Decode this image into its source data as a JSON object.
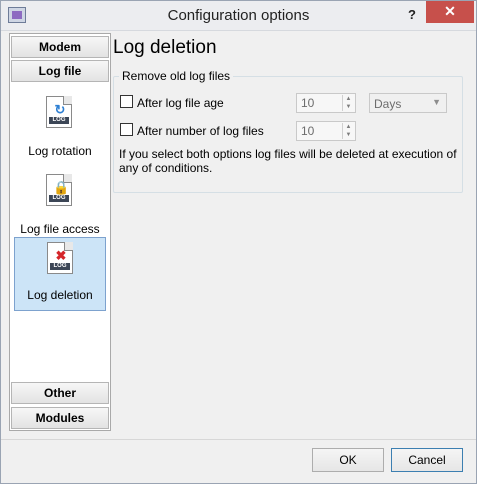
{
  "window": {
    "title": "Configuration options",
    "help_label": "?",
    "close_label": "✕"
  },
  "sidebar": {
    "top_buttons": [
      {
        "label": "Modem"
      },
      {
        "label": "Log file"
      }
    ],
    "items": [
      {
        "label": "Log rotation",
        "icon": "log-rotation-icon"
      },
      {
        "label": "Log file access",
        "icon": "log-file-access-icon"
      },
      {
        "label": "Log deletion",
        "icon": "log-deletion-icon",
        "selected": true
      }
    ],
    "bottom_buttons": [
      {
        "label": "Other"
      },
      {
        "label": "Modules"
      }
    ],
    "icon_tag": "LOG"
  },
  "main": {
    "title": "Log deletion",
    "group_label": "Remove old log files",
    "options": [
      {
        "label": "After log file age",
        "checked": false,
        "value": "10",
        "unit": "Days"
      },
      {
        "label": "After number of log files",
        "checked": false,
        "value": "10"
      }
    ],
    "note": "If you select both options log files will be deleted at execution of any of conditions."
  },
  "footer": {
    "ok_label": "OK",
    "cancel_label": "Cancel"
  }
}
